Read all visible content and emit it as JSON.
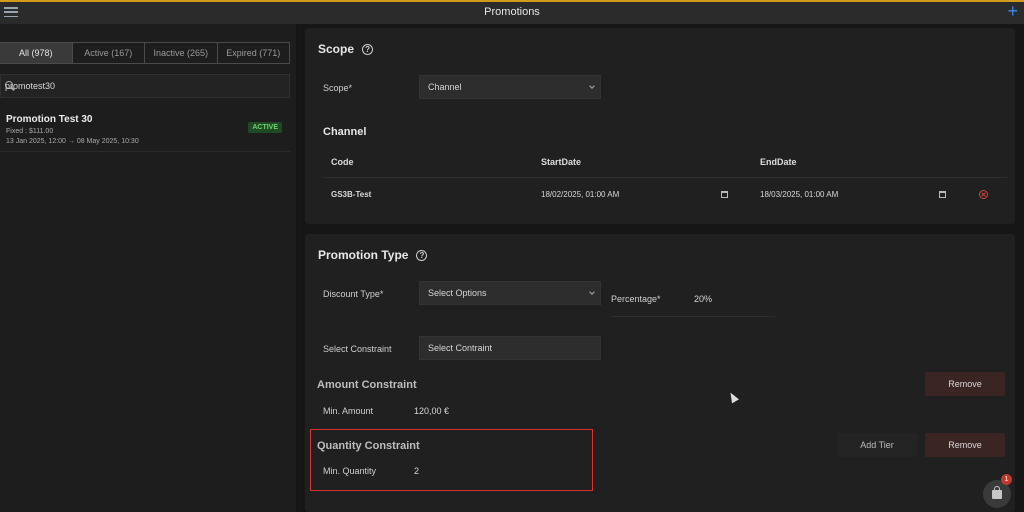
{
  "app": {
    "title": "Promotions"
  },
  "filters": {
    "tabs": [
      {
        "label": "All (978)"
      },
      {
        "label": "Active (167)"
      },
      {
        "label": "Inactive (265)"
      },
      {
        "label": "Expired (771)"
      }
    ],
    "search_value": "promotest30"
  },
  "promotion": {
    "name": "Promotion Test 30",
    "fixed_label": "Fixed : $111.00",
    "date_range": "13 Jan 2025, 12:00 → 08 May 2025, 10:30",
    "status": "ACTIVE"
  },
  "scope": {
    "title": "Scope",
    "help_glyph": "?",
    "scope_label": "Scope*",
    "scope_value": "Channel",
    "channel_title": "Channel",
    "columns": [
      "Code",
      "StartDate",
      "EndDate"
    ],
    "rows": [
      {
        "code": "GS3B-Test",
        "start": "18/02/2025, 01:00 AM",
        "end": "18/03/2025, 01:00 AM"
      }
    ]
  },
  "promotion_type": {
    "title": "Promotion Type",
    "help_glyph": "?",
    "discount_label": "Discount Type*",
    "discount_value": "Select Options",
    "percentage_label": "Percentage*",
    "percentage_value": "20%",
    "constraint_label": "Select Constraint",
    "constraint_value": "Select Contraint",
    "amount": {
      "title": "Amount Constraint",
      "min_label": "Min. Amount",
      "min_value": "120,00 €",
      "remove": "Remove"
    },
    "quantity": {
      "title": "Quantity Constraint",
      "min_label": "Min. Quantity",
      "min_value": "2",
      "add_tier": "Add Tier",
      "remove": "Remove"
    }
  },
  "cart": {
    "count": "1"
  },
  "colors": {
    "accent": "#d19a1a",
    "plus": "#3d8ae6",
    "highlight": "#d6322b",
    "active_badge": "#6fd16f"
  }
}
